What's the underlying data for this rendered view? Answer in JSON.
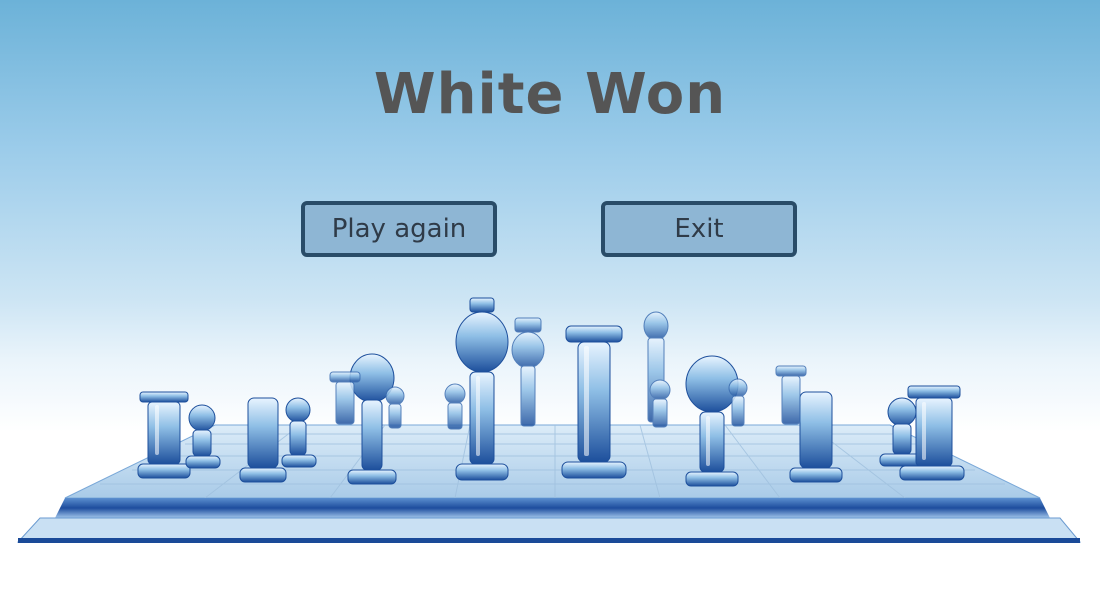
{
  "title": "White Won",
  "buttons": {
    "play_again": "Play again",
    "exit": "Exit"
  },
  "colors": {
    "sky_top": "#6cb2d8",
    "title_text": "#555555",
    "button_fill": "#8eb6d4",
    "button_border": "#294c68",
    "board_glass": "#9cc6e6"
  }
}
